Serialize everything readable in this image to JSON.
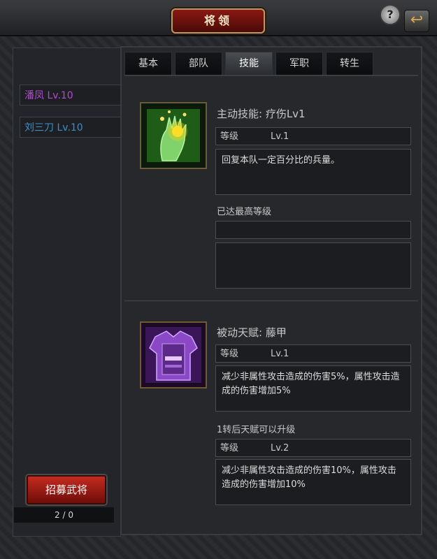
{
  "window": {
    "title": "将领"
  },
  "generals": [
    {
      "name": "潘凤",
      "level": "Lv.10",
      "color": "#b24bd2"
    },
    {
      "name": "刘三刀",
      "level": "Lv.10",
      "color": "#3d8fc7"
    }
  ],
  "tabs": [
    "基本",
    "部队",
    "技能",
    "军职",
    "转生"
  ],
  "active_tab": "技能",
  "skill": {
    "title": "主动技能: 疗伤Lv1",
    "level_label": "等级",
    "level_value": "Lv.1",
    "description": "回复本队一定百分比的兵量。",
    "max_label": "已达最高等级",
    "next_level_row": "",
    "next_desc": ""
  },
  "talent": {
    "title": "被动天赋: 藤甲",
    "level_label": "等级",
    "level_value": "Lv.1",
    "description": "减少非属性攻击造成的伤害5%，属性攻击造成的伤害增加5%",
    "upgrade_note": "1转后天赋可以升级",
    "next_level_label": "等级",
    "next_level_value": "Lv.2",
    "next_description": "减少非属性攻击造成的伤害10%，属性攻击造成的伤害增加10%"
  },
  "recruit": {
    "label": "招募武将",
    "count": "2 / 0"
  },
  "buttons": {
    "help": "?",
    "back": "↩"
  }
}
